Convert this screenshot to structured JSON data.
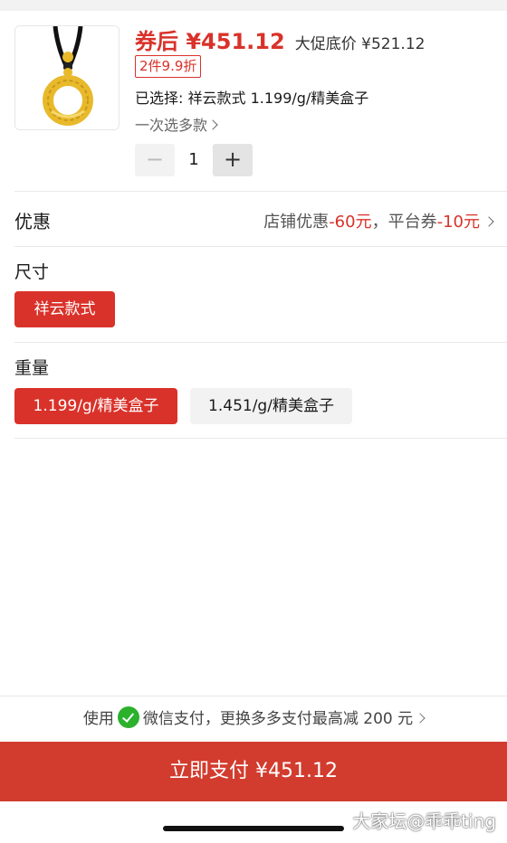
{
  "product": {
    "price_after_coupon": "券后 ¥451.12",
    "promo_price": "大促底价 ¥521.12",
    "promo_badge": "2件9.9折",
    "selected_spec": "已选择: 祥云款式 1.199/g/精美盒子",
    "multi_select": "一次选多款",
    "quantity": "1",
    "minus_label": "−",
    "plus_label": "+"
  },
  "discount": {
    "title": "优惠",
    "shop_label": "店铺优惠",
    "shop_value": "-60元",
    "separator": "，",
    "platform_label": "平台券",
    "platform_value": "-10元"
  },
  "size": {
    "title": "尺寸",
    "options": [
      "祥云款式"
    ]
  },
  "weight": {
    "title": "重量",
    "options": [
      "1.199/g/精美盒子",
      "1.451/g/精美盒子"
    ]
  },
  "payment": {
    "use_label": "使用",
    "method": "微信支付",
    "promo_text": "，更换多多支付最高减 200 元",
    "pay_button": "立即支付 ¥451.12"
  },
  "watermark": "大家坛@乖乖ting",
  "colors": {
    "accent": "#d9322a",
    "wechat": "#2bb12c",
    "gold": "#e8b92a"
  },
  "icons": [
    "pendant-image",
    "chevron-right-icon",
    "wechat-pay-icon"
  ]
}
